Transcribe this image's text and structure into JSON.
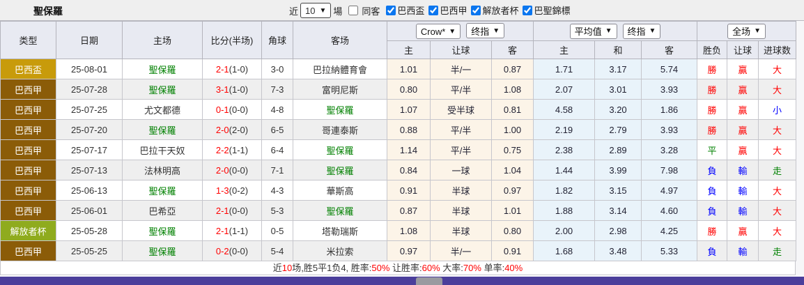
{
  "page": {
    "title": "聖保羅",
    "bottom_bar_color": "#4b3e9b"
  },
  "controls": {
    "near_label": "近",
    "count_value": "10",
    "unit_label": "場",
    "same_away": {
      "label": "同客",
      "checked": false
    },
    "league_filters": [
      {
        "label": "巴西盃",
        "checked": true
      },
      {
        "label": "巴西甲",
        "checked": true
      },
      {
        "label": "解放者杯",
        "checked": true
      },
      {
        "label": "巴聖錦標",
        "checked": true
      }
    ]
  },
  "table": {
    "columns": {
      "type": "类型",
      "date": "日期",
      "home": "主场",
      "score": "比分(半场)",
      "corner": "角球",
      "away": "客场",
      "g1_home": "主",
      "g1_handicap": "让球",
      "g1_away": "客",
      "g2_home": "主",
      "g2_draw": "和",
      "g2_away": "客",
      "g3_wdl": "胜负",
      "g3_handicap": "让球",
      "g3_goals": "进球数"
    },
    "selects": {
      "crow": "Crow*",
      "crow_final": "终指",
      "average": "平均值",
      "average_final": "终指",
      "fulltime": "全场"
    },
    "rows": [
      {
        "league": "巴西盃",
        "league_color": "#c89b0b",
        "date": "25-08-01",
        "home": "聖保羅",
        "home_active": true,
        "score_ft": "2-1",
        "score_ht": "(1-0)",
        "corner": "3-0",
        "away": "巴拉納體育會",
        "away_active": false,
        "crow_home": "1.01",
        "crow_handicap": "半/一",
        "crow_away": "0.87",
        "avg_home": "1.71",
        "avg_draw": "3.17",
        "avg_away": "5.74",
        "res_wdl": "勝",
        "res_wdl_color": "#ff0000",
        "res_handicap": "贏",
        "res_handicap_color": "#ff0000",
        "res_goals": "大",
        "res_goals_color": "#ff0000"
      },
      {
        "league": "巴西甲",
        "league_color": "#8b5c08",
        "date": "25-07-28",
        "home": "聖保羅",
        "home_active": true,
        "score_ft": "3-1",
        "score_ht": "(1-0)",
        "corner": "7-3",
        "away": "富明尼斯",
        "away_active": false,
        "crow_home": "0.80",
        "crow_handicap": "平/半",
        "crow_away": "1.08",
        "avg_home": "2.07",
        "avg_draw": "3.01",
        "avg_away": "3.93",
        "res_wdl": "勝",
        "res_wdl_color": "#ff0000",
        "res_handicap": "贏",
        "res_handicap_color": "#ff0000",
        "res_goals": "大",
        "res_goals_color": "#ff0000"
      },
      {
        "league": "巴西甲",
        "league_color": "#8b5c08",
        "date": "25-07-25",
        "home": "尤文都德",
        "home_active": false,
        "score_ft": "0-1",
        "score_ht": "(0-0)",
        "corner": "4-8",
        "away": "聖保羅",
        "away_active": true,
        "crow_home": "1.07",
        "crow_handicap": "受半球",
        "crow_away": "0.81",
        "avg_home": "4.58",
        "avg_draw": "3.20",
        "avg_away": "1.86",
        "res_wdl": "勝",
        "res_wdl_color": "#ff0000",
        "res_handicap": "贏",
        "res_handicap_color": "#ff0000",
        "res_goals": "小",
        "res_goals_color": "#0000ff"
      },
      {
        "league": "巴西甲",
        "league_color": "#8b5c08",
        "date": "25-07-20",
        "home": "聖保羅",
        "home_active": true,
        "score_ft": "2-0",
        "score_ht": "(2-0)",
        "corner": "6-5",
        "away": "哥連泰斯",
        "away_active": false,
        "crow_home": "0.88",
        "crow_handicap": "平/半",
        "crow_away": "1.00",
        "avg_home": "2.19",
        "avg_draw": "2.79",
        "avg_away": "3.93",
        "res_wdl": "勝",
        "res_wdl_color": "#ff0000",
        "res_handicap": "贏",
        "res_handicap_color": "#ff0000",
        "res_goals": "大",
        "res_goals_color": "#ff0000"
      },
      {
        "league": "巴西甲",
        "league_color": "#8b5c08",
        "date": "25-07-17",
        "home": "巴拉干天奴",
        "home_active": false,
        "score_ft": "2-2",
        "score_ht": "(1-1)",
        "corner": "6-4",
        "away": "聖保羅",
        "away_active": true,
        "crow_home": "1.14",
        "crow_handicap": "平/半",
        "crow_away": "0.75",
        "avg_home": "2.38",
        "avg_draw": "2.89",
        "avg_away": "3.28",
        "res_wdl": "平",
        "res_wdl_color": "#008000",
        "res_handicap": "贏",
        "res_handicap_color": "#ff0000",
        "res_goals": "大",
        "res_goals_color": "#ff0000"
      },
      {
        "league": "巴西甲",
        "league_color": "#8b5c08",
        "date": "25-07-13",
        "home": "法林明高",
        "home_active": false,
        "score_ft": "2-0",
        "score_ht": "(0-0)",
        "corner": "7-1",
        "away": "聖保羅",
        "away_active": true,
        "crow_home": "0.84",
        "crow_handicap": "一球",
        "crow_away": "1.04",
        "avg_home": "1.44",
        "avg_draw": "3.99",
        "avg_away": "7.98",
        "res_wdl": "負",
        "res_wdl_color": "#0000ff",
        "res_handicap": "輸",
        "res_handicap_color": "#0000ff",
        "res_goals": "走",
        "res_goals_color": "#008000"
      },
      {
        "league": "巴西甲",
        "league_color": "#8b5c08",
        "date": "25-06-13",
        "home": "聖保羅",
        "home_active": true,
        "score_ft": "1-3",
        "score_ht": "(0-2)",
        "corner": "4-3",
        "away": "華斯高",
        "away_active": false,
        "crow_home": "0.91",
        "crow_handicap": "半球",
        "crow_away": "0.97",
        "avg_home": "1.82",
        "avg_draw": "3.15",
        "avg_away": "4.97",
        "res_wdl": "負",
        "res_wdl_color": "#0000ff",
        "res_handicap": "輸",
        "res_handicap_color": "#0000ff",
        "res_goals": "大",
        "res_goals_color": "#ff0000"
      },
      {
        "league": "巴西甲",
        "league_color": "#8b5c08",
        "date": "25-06-01",
        "home": "巴希亞",
        "home_active": false,
        "score_ft": "2-1",
        "score_ht": "(0-0)",
        "corner": "5-3",
        "away": "聖保羅",
        "away_active": true,
        "crow_home": "0.87",
        "crow_handicap": "半球",
        "crow_away": "1.01",
        "avg_home": "1.88",
        "avg_draw": "3.14",
        "avg_away": "4.60",
        "res_wdl": "負",
        "res_wdl_color": "#0000ff",
        "res_handicap": "輸",
        "res_handicap_color": "#0000ff",
        "res_goals": "大",
        "res_goals_color": "#ff0000"
      },
      {
        "league": "解放者杯",
        "league_color": "#8fab1e",
        "date": "25-05-28",
        "home": "聖保羅",
        "home_active": true,
        "score_ft": "2-1",
        "score_ht": "(1-1)",
        "corner": "0-5",
        "away": "塔勒瑞斯",
        "away_active": false,
        "crow_home": "1.08",
        "crow_handicap": "半球",
        "crow_away": "0.80",
        "avg_home": "2.00",
        "avg_draw": "2.98",
        "avg_away": "4.25",
        "res_wdl": "勝",
        "res_wdl_color": "#ff0000",
        "res_handicap": "贏",
        "res_handicap_color": "#ff0000",
        "res_goals": "大",
        "res_goals_color": "#ff0000"
      },
      {
        "league": "巴西甲",
        "league_color": "#8b5c08",
        "date": "25-05-25",
        "home": "聖保羅",
        "home_active": true,
        "score_ft": "0-2",
        "score_ht": "(0-0)",
        "corner": "5-4",
        "away": "米拉索",
        "away_active": false,
        "crow_home": "0.97",
        "crow_handicap": "半/一",
        "crow_away": "0.91",
        "avg_home": "1.68",
        "avg_draw": "3.48",
        "avg_away": "5.33",
        "res_wdl": "負",
        "res_wdl_color": "#0000ff",
        "res_handicap": "輸",
        "res_handicap_color": "#0000ff",
        "res_goals": "走",
        "res_goals_color": "#008000"
      }
    ]
  },
  "summary": {
    "parts": [
      {
        "text": "近",
        "red": false
      },
      {
        "text": "10",
        "red": true
      },
      {
        "text": "场,胜5平1负4, 胜率:",
        "red": false
      },
      {
        "text": "50%",
        "red": true
      },
      {
        "text": " 让胜率:",
        "red": false
      },
      {
        "text": "60%",
        "red": true
      },
      {
        "text": " 大率:",
        "red": false
      },
      {
        "text": "70%",
        "red": true
      },
      {
        "text": " 单率:",
        "red": false
      },
      {
        "text": "40%",
        "red": true
      }
    ]
  }
}
